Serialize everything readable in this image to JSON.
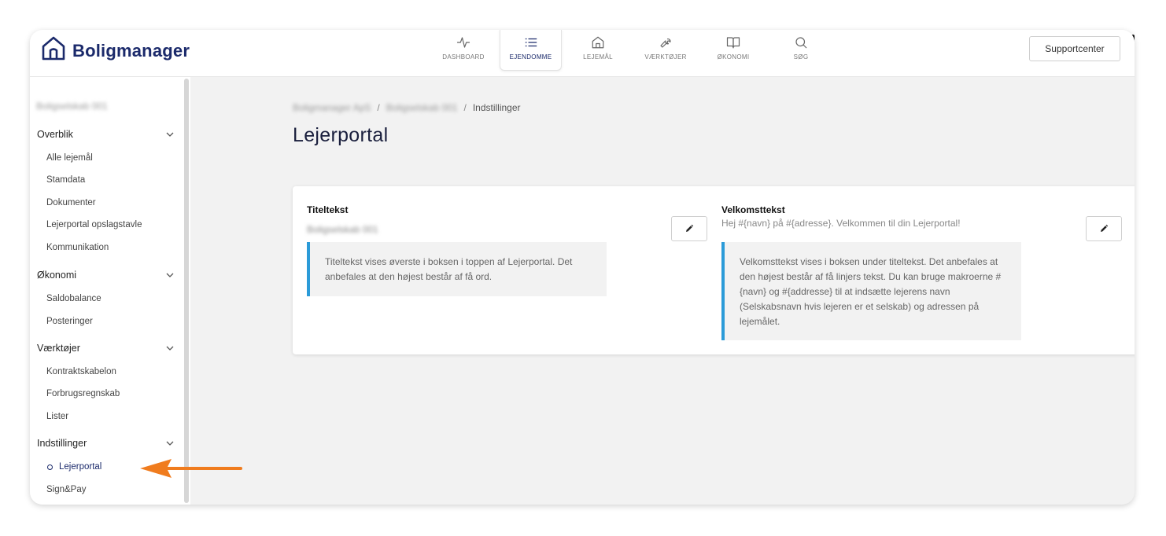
{
  "app": {
    "logo_text": "Boligmanager",
    "support_label": "Supportcenter"
  },
  "nav": [
    {
      "label": "DASHBOARD",
      "icon": "activity-icon"
    },
    {
      "label": "EJENDOMME",
      "icon": "list-icon",
      "active": true
    },
    {
      "label": "LEJEMÅL",
      "icon": "home-icon"
    },
    {
      "label": "VÆRKTØJER",
      "icon": "wrench-icon"
    },
    {
      "label": "ØKONOMI",
      "icon": "book-icon"
    },
    {
      "label": "SØG",
      "icon": "search-icon"
    }
  ],
  "sidebar": {
    "company": "Boligselskab 001",
    "sections": [
      {
        "label": "Overblik",
        "items": [
          "Alle lejemål",
          "Stamdata",
          "Dokumenter",
          "Lejerportal opslagstavle",
          "Kommunikation"
        ]
      },
      {
        "label": "Økonomi",
        "items": [
          "Saldobalance",
          "Posteringer"
        ]
      },
      {
        "label": "Værktøjer",
        "items": [
          "Kontraktskabelon",
          "Forbrugsregnskab",
          "Lister"
        ]
      },
      {
        "label": "Indstillinger",
        "items": [
          "Lejerportal",
          "Sign&Pay"
        ]
      }
    ],
    "active_item": "Lejerportal"
  },
  "breadcrumb": {
    "first": "Boligmanager ApS",
    "second": "Boligselskab 001",
    "current": "Indstillinger",
    "separator": "/"
  },
  "page": {
    "title": "Lejerportal"
  },
  "card": {
    "title_field": {
      "label": "Titeltekst",
      "value": "Boligselskab 001",
      "info": "Titeltekst vises øverste i boksen i toppen af Lejerportal. Det anbefales at den højest består af få ord."
    },
    "welcome_field": {
      "label": "Velkomsttekst",
      "value": "Hej #{navn} på #{adresse}. Velkommen til din Lejerportal!",
      "info": "Velkomsttekst vises i boksen under titeltekst. Det anbefales at den højest består af få linjers tekst. Du kan bruge makroerne #{navn} og #{addresse} til at indsætte lejerens navn (Selskabsnavn hvis lejeren er et selskab) og adressen på lejemålet."
    }
  },
  "colors": {
    "brand": "#1b2a6b",
    "accent_border": "#2b9bd8",
    "arrow": "#f07c1e"
  }
}
